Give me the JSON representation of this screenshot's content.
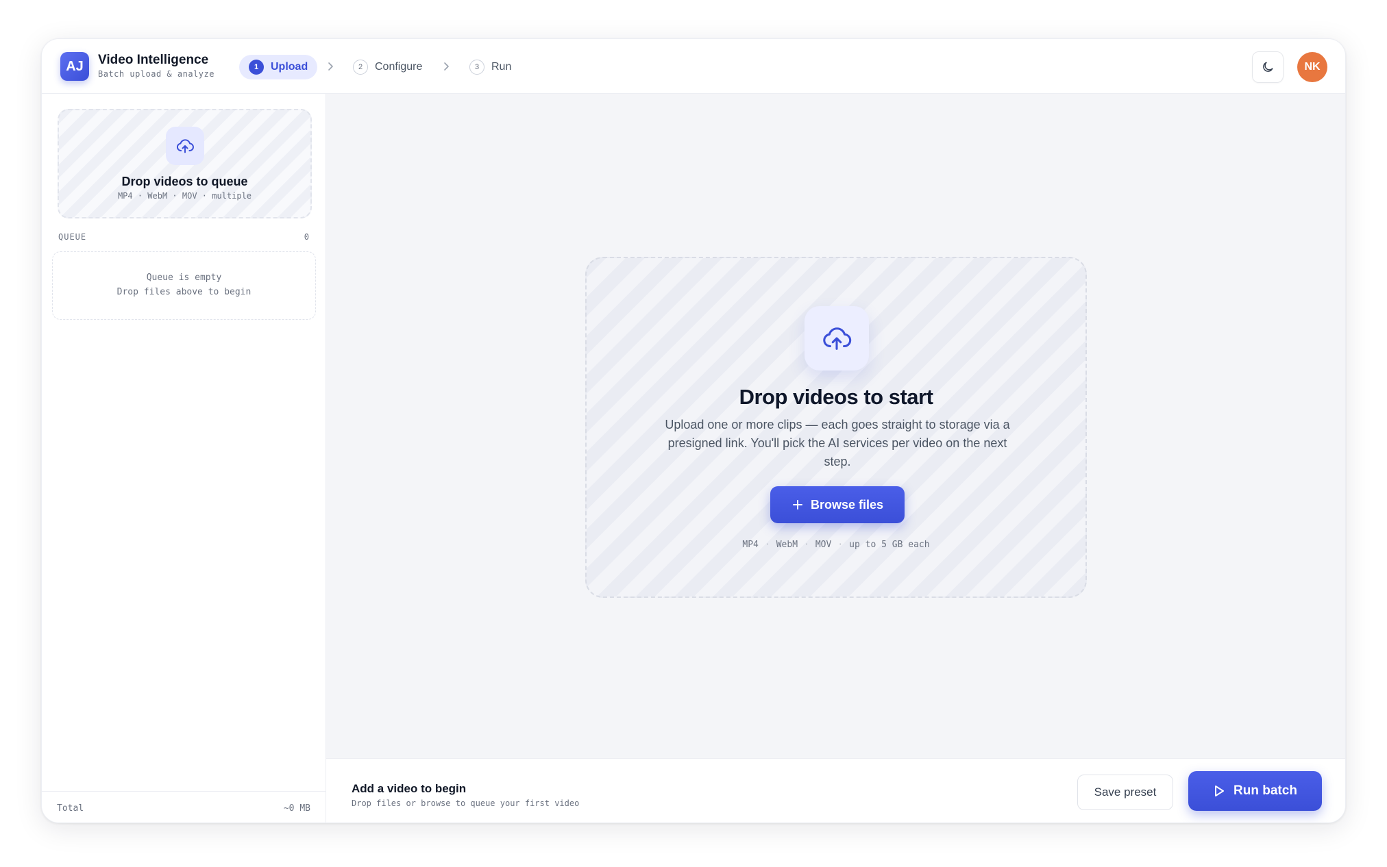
{
  "header": {
    "logo_text": "AJ",
    "title": "Video Intelligence",
    "subtitle": "Batch upload & analyze",
    "steps": [
      {
        "num": "1",
        "label": "Upload",
        "active": true
      },
      {
        "num": "2",
        "label": "Configure",
        "active": false
      },
      {
        "num": "3",
        "label": "Run",
        "active": false
      }
    ],
    "theme_icon": "moon-icon",
    "avatar_initials": "NK"
  },
  "sidebar": {
    "drop_title": "Drop videos to queue",
    "drop_subtitle": "MP4 · WebM · MOV · multiple",
    "drop_icon": "cloud-upload-icon",
    "queue_label": "QUEUE",
    "queue_count": "0",
    "queue_empty_line1": "Queue is empty",
    "queue_empty_line2": "Drop files above to begin",
    "total_label": "Total",
    "total_value": "~0 MB"
  },
  "main": {
    "drop_icon": "cloud-upload-icon",
    "drop_title": "Drop videos to start",
    "drop_description": "Upload one or more clips — each goes straight to storage via a presigned link. You'll pick the AI services per video on the next step.",
    "browse_label": "Browse files",
    "formats": [
      "MP4",
      "WebM",
      "MOV",
      "up to 5 GB each"
    ]
  },
  "footer": {
    "title": "Add a video to begin",
    "subtitle": "Drop files or browse to queue your first video",
    "save_label": "Save preset",
    "run_label": "Run batch"
  },
  "colors": {
    "accent": "#3b4fd8",
    "avatar": "#e8773f",
    "main_bg": "#f4f5f8"
  }
}
